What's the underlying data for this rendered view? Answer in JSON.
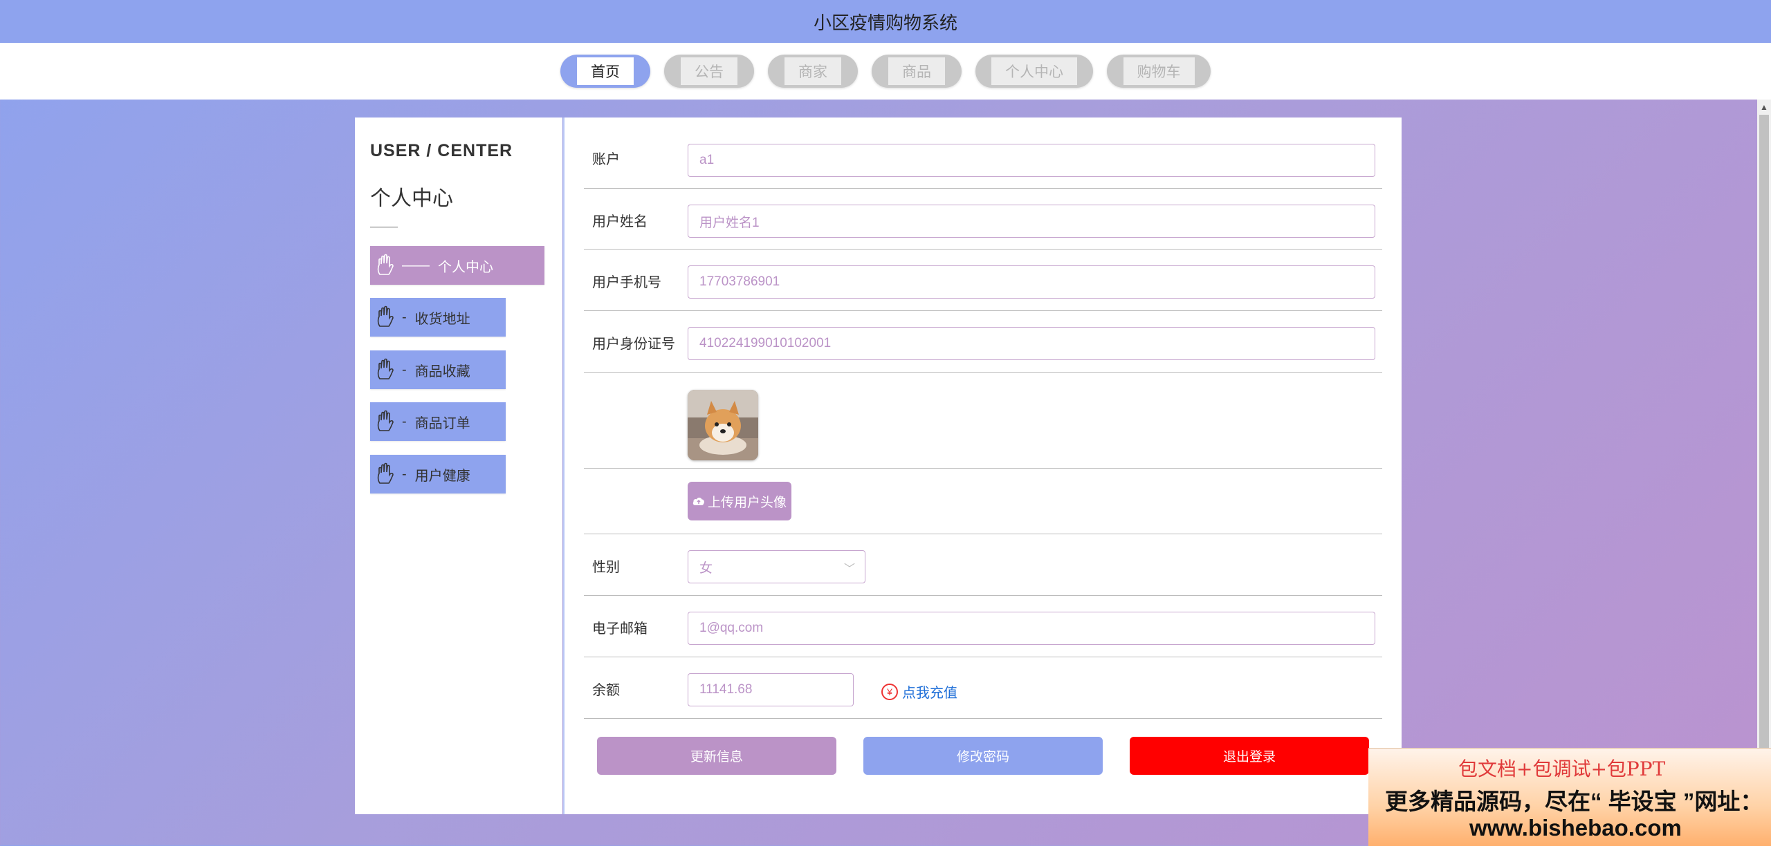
{
  "header": {
    "title": "小区疫情购物系统"
  },
  "nav": [
    {
      "label": "首页",
      "active": true
    },
    {
      "label": "公告",
      "active": false
    },
    {
      "label": "商家",
      "active": false
    },
    {
      "label": "商品",
      "active": false
    },
    {
      "label": "个人中心",
      "active": false
    },
    {
      "label": "购物车",
      "active": false
    }
  ],
  "sidebar": {
    "title_en": "USER / CENTER",
    "title_cn": "个人中心",
    "items": [
      {
        "label": "个人中心",
        "dash": "——",
        "active": true
      },
      {
        "label": "收货地址",
        "dash": "-",
        "active": false
      },
      {
        "label": "商品收藏",
        "dash": "-",
        "active": false
      },
      {
        "label": "商品订单",
        "dash": "-",
        "active": false
      },
      {
        "label": "用户健康",
        "dash": "-",
        "active": false
      }
    ]
  },
  "form": {
    "account": {
      "label": "账户",
      "value": "a1"
    },
    "name": {
      "label": "用户姓名",
      "value": "用户姓名1"
    },
    "phone": {
      "label": "用户手机号",
      "value": "17703786901"
    },
    "idcard": {
      "label": "用户身份证号",
      "value": "410224199010102001"
    },
    "upload_label": "上传用户头像",
    "gender": {
      "label": "性别",
      "value": "女"
    },
    "email": {
      "label": "电子邮箱",
      "value": "1@qq.com"
    },
    "balance": {
      "label": "余额",
      "value": "11141.68"
    },
    "recharge_label": "点我充值",
    "recharge_icon_glyph": "¥"
  },
  "buttons": {
    "update": "更新信息",
    "change_password": "修改密码",
    "logout": "退出登录"
  },
  "promo": {
    "line1": "包文档+包调试+包PPT",
    "line2": "更多精品源码，尽在“ 毕设宝 ”网址：",
    "line3": "www.bishebao.com"
  },
  "colors": {
    "primary": "#8ea3ee",
    "accent": "#bb93c7",
    "danger": "#ff0000",
    "link": "#1f6fd8"
  },
  "icons": {
    "menu": "hand-icon",
    "upload": "cloud-upload-icon",
    "recharge": "yen-icon",
    "select": "chevron-down-icon"
  }
}
